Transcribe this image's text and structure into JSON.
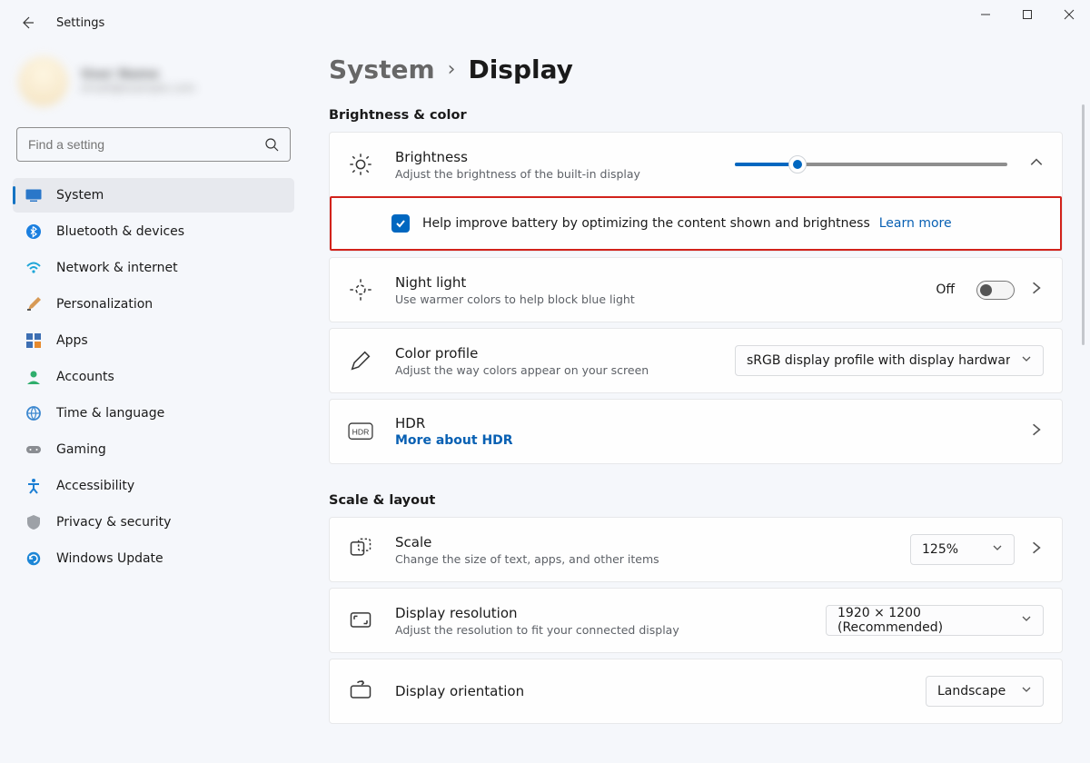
{
  "app_title": "Settings",
  "profile": {
    "name": "User Name",
    "email": "email@example.com"
  },
  "search": {
    "placeholder": "Find a setting"
  },
  "sidebar": {
    "items": [
      {
        "label": "System"
      },
      {
        "label": "Bluetooth & devices"
      },
      {
        "label": "Network & internet"
      },
      {
        "label": "Personalization"
      },
      {
        "label": "Apps"
      },
      {
        "label": "Accounts"
      },
      {
        "label": "Time & language"
      },
      {
        "label": "Gaming"
      },
      {
        "label": "Accessibility"
      },
      {
        "label": "Privacy & security"
      },
      {
        "label": "Windows Update"
      }
    ]
  },
  "breadcrumb": {
    "parent": "System",
    "sep": "›",
    "current": "Display"
  },
  "sections": {
    "bc_title": "Brightness & color",
    "sl_title": "Scale & layout"
  },
  "brightness": {
    "title": "Brightness",
    "desc": "Adjust the brightness of the built-in display",
    "value_pct": 23,
    "opt_label": "Help improve battery by optimizing the content shown and brightness",
    "learn_more": "Learn more"
  },
  "night_light": {
    "title": "Night light",
    "desc": "Use warmer colors to help block blue light",
    "state_text": "Off"
  },
  "color_profile": {
    "title": "Color profile",
    "desc": "Adjust the way colors appear on your screen",
    "value": "sRGB display profile with display hardware c"
  },
  "hdr": {
    "title": "HDR",
    "link": "More about HDR"
  },
  "scale": {
    "title": "Scale",
    "desc": "Change the size of text, apps, and other items",
    "value": "125%"
  },
  "resolution": {
    "title": "Display resolution",
    "desc": "Adjust the resolution to fit your connected display",
    "value": "1920 × 1200 (Recommended)"
  },
  "orientation": {
    "title": "Display orientation",
    "value": "Landscape"
  }
}
